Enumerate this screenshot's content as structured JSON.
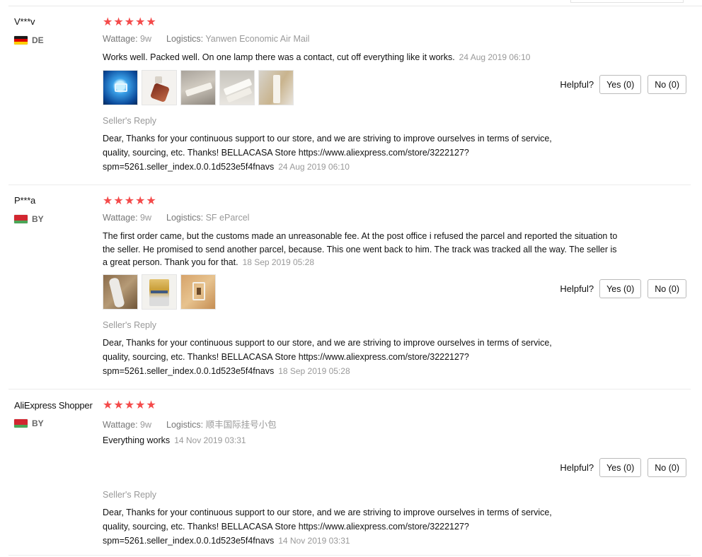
{
  "labels": {
    "wattage": "Wattage:",
    "logistics": "Logistics:",
    "helpful": "Helpful?",
    "sellers_reply": "Seller's Reply"
  },
  "reviews": [
    {
      "user": "V***v",
      "country": "DE",
      "flag": [
        "#1a1a1a",
        "#dd0000",
        "#ffce00"
      ],
      "stars": "★★★★★",
      "wattage": "9w",
      "logistics": "Yanwen Economic Air Mail",
      "text": "Works well. Packed well. On one lamp there was a contact, cut off everything like it works.",
      "date": "24 Aug 2019 06:10",
      "yes": "Yes (0)",
      "no": "No (0)",
      "reply": "Dear, Thanks for your continuous support to our store, and we are striving to improve ourselves in terms of service, quality, sourcing, etc. Thanks! BELLACASA Store https://www.aliexpress.com/store/3222127?spm=5261.seller_index.0.0.1d523e5f4fnavs",
      "reply_date": "24 Aug 2019 06:10"
    },
    {
      "user": "P***a",
      "country": "BY",
      "flag": [
        "#d22730",
        "#d22730",
        "#4aa657"
      ],
      "stars": "★★★★★",
      "wattage": "9w",
      "logistics": "SF eParcel",
      "text": "The first order came, but the customs made an unreasonable fee. At the post office i refused the parcel and reported the situation to the seller. He promised to send another parcel, because. This one went back to him. The track was tracked all the way. The seller is a great person. Thank you for that.",
      "date": "18 Sep 2019 05:28",
      "yes": "Yes (0)",
      "no": "No (0)",
      "reply": "Dear, Thanks for your continuous support to our store, and we are striving to improve ourselves in terms of service, quality, sourcing, etc. Thanks! BELLACASA Store https://www.aliexpress.com/store/3222127?spm=5261.seller_index.0.0.1d523e5f4fnavs",
      "reply_date": "18 Sep 2019 05:28"
    },
    {
      "user": "AliExpress Shopper",
      "country": "BY",
      "flag": [
        "#d22730",
        "#d22730",
        "#4aa657"
      ],
      "stars": "★★★★★",
      "wattage": "9w",
      "logistics": "顺丰国际挂号小包",
      "text": "Everything works",
      "date": "14 Nov 2019 03:31",
      "yes": "Yes (0)",
      "no": "No (0)",
      "reply": "Dear, Thanks for your continuous support to our store, and we are striving to improve ourselves in terms of service, quality, sourcing, etc. Thanks! BELLACASA Store https://www.aliexpress.com/store/3222127?spm=5261.seller_index.0.0.1d523e5f4fnavs",
      "reply_date": "14 Nov 2019 03:31"
    }
  ]
}
